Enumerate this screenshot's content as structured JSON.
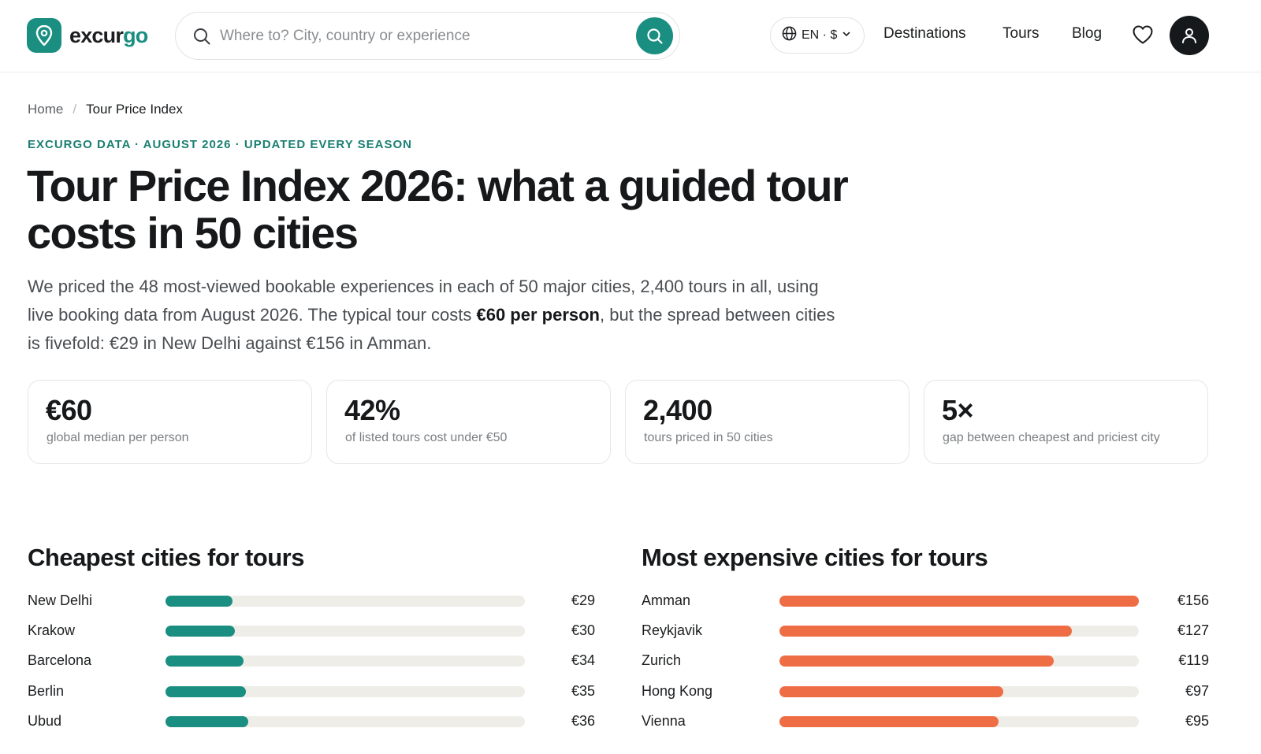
{
  "header": {
    "logo": {
      "text_main": "excur",
      "text_accent": "go"
    },
    "search": {
      "placeholder": "Where to? City, country or experience"
    },
    "lang": {
      "label": "EN · $"
    },
    "nav": [
      {
        "label": "Destinations"
      },
      {
        "label": "Tours"
      },
      {
        "label": "Blog"
      }
    ]
  },
  "breadcrumb": {
    "home": "Home",
    "separator": "/",
    "current": "Tour Price Index"
  },
  "eyebrow": "EXCURGO DATA · AUGUST 2026 · UPDATED EVERY SEASON",
  "title": "Tour Price Index 2026: what a guided tour costs in 50 cities",
  "lead": {
    "part1": "We priced the 48 most-viewed bookable experiences in each of 50 major cities, 2,400 tours in all, using live booking data from August 2026. The typical tour costs ",
    "bold": "€60 per person",
    "part2": ", but the spread between cities is fivefold: €29 in New Delhi against €156 in Amman."
  },
  "stats": [
    {
      "value": "€60",
      "label": "global median per person"
    },
    {
      "value": "42%",
      "label": "of listed tours cost under €50"
    },
    {
      "value": "2,400",
      "label": "tours priced in 50 cities"
    },
    {
      "value": "5×",
      "label": "gap between cheapest and priciest city"
    }
  ],
  "cheapest": {
    "title": "Cheapest cities for tours",
    "color": "#1a8e80",
    "max_value": 156,
    "rows": [
      {
        "city": "New Delhi",
        "price": "€29",
        "value": 29
      },
      {
        "city": "Krakow",
        "price": "€30",
        "value": 30
      },
      {
        "city": "Barcelona",
        "price": "€34",
        "value": 34
      },
      {
        "city": "Berlin",
        "price": "€35",
        "value": 35
      },
      {
        "city": "Ubud",
        "price": "€36",
        "value": 36
      }
    ]
  },
  "expensive": {
    "title": "Most expensive cities for tours",
    "color": "#ef6d45",
    "max_value": 156,
    "rows": [
      {
        "city": "Amman",
        "price": "€156",
        "value": 156
      },
      {
        "city": "Reykjavik",
        "price": "€127",
        "value": 127
      },
      {
        "city": "Zurich",
        "price": "€119",
        "value": 119
      },
      {
        "city": "Hong Kong",
        "price": "€97",
        "value": 97
      },
      {
        "city": "Vienna",
        "price": "€95",
        "value": 95
      }
    ]
  }
}
